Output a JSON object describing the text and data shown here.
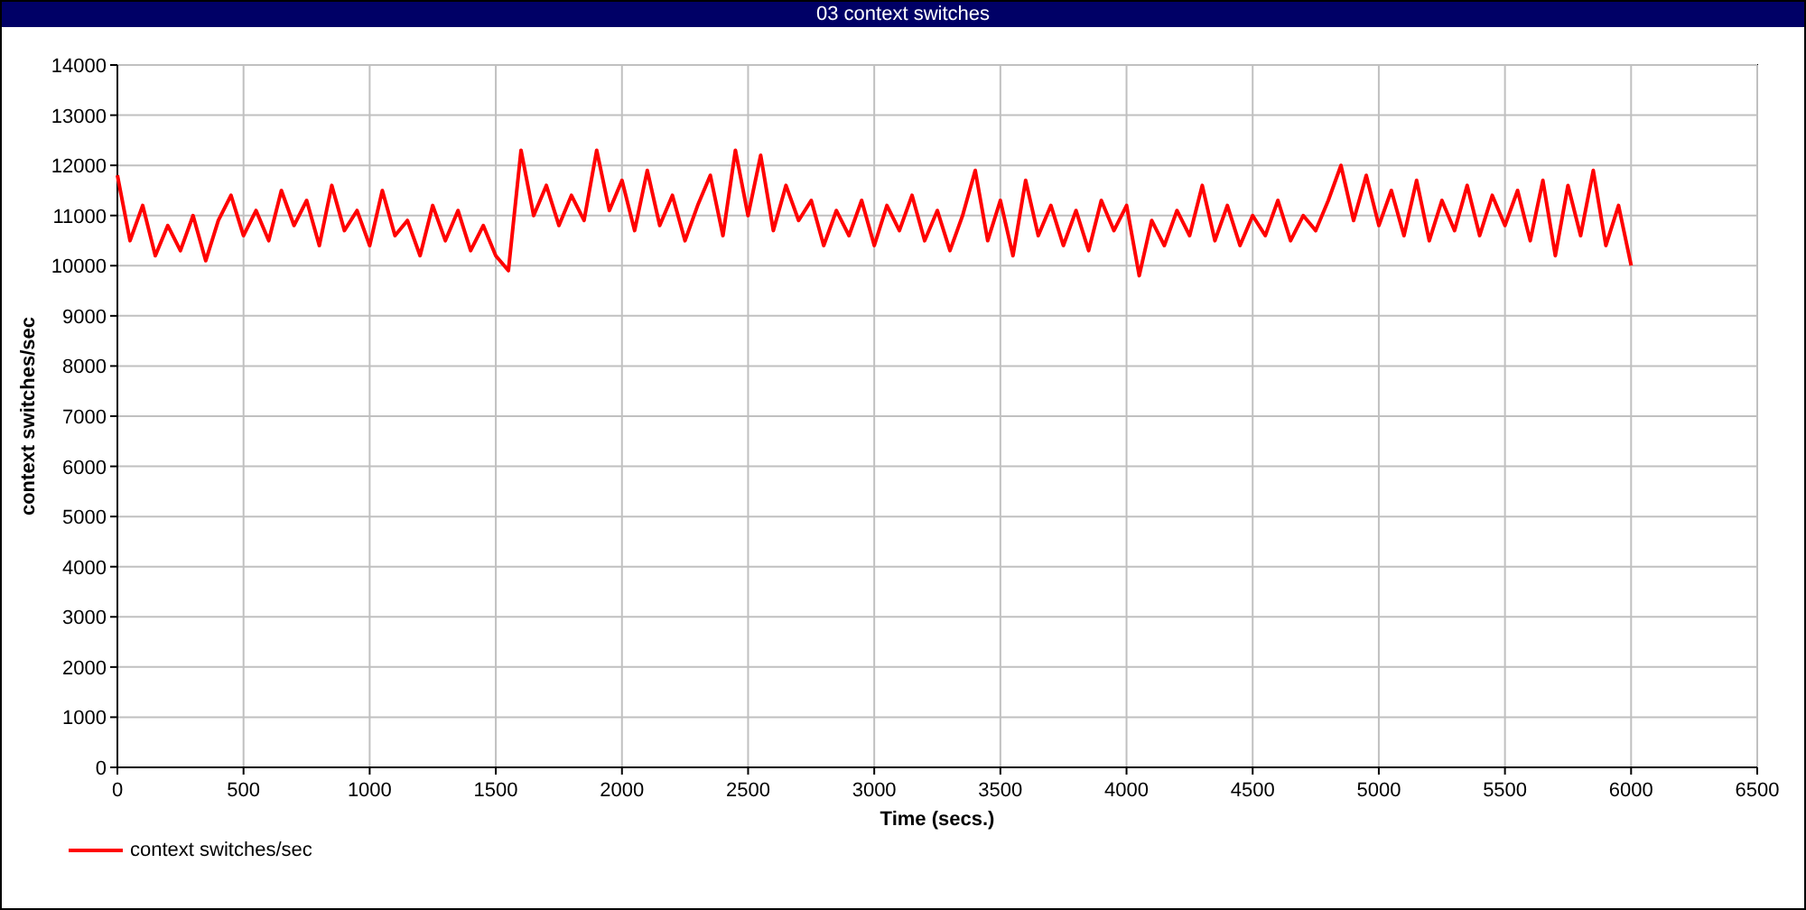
{
  "window": {
    "title": "03 context switches"
  },
  "chart": {
    "chart_data": {
      "type": "line",
      "grid": true,
      "xlabel": "Time (secs.)",
      "ylabel": "context switches/sec",
      "xlim": [
        0,
        6500
      ],
      "ylim": [
        0,
        14000
      ],
      "xticks": [
        0,
        500,
        1000,
        1500,
        2000,
        2500,
        3000,
        3500,
        4000,
        4500,
        5000,
        5500,
        6000,
        6500
      ],
      "yticks": [
        0,
        1000,
        2000,
        3000,
        4000,
        5000,
        6000,
        7000,
        8000,
        9000,
        10000,
        11000,
        12000,
        13000,
        14000
      ],
      "x": [
        0,
        50,
        100,
        150,
        200,
        250,
        300,
        350,
        400,
        450,
        500,
        550,
        600,
        650,
        700,
        750,
        800,
        850,
        900,
        950,
        1000,
        1050,
        1100,
        1150,
        1200,
        1250,
        1300,
        1350,
        1400,
        1450,
        1500,
        1550,
        1600,
        1650,
        1700,
        1750,
        1800,
        1850,
        1900,
        1950,
        2000,
        2050,
        2100,
        2150,
        2200,
        2250,
        2300,
        2350,
        2400,
        2450,
        2500,
        2550,
        2600,
        2650,
        2700,
        2750,
        2800,
        2850,
        2900,
        2950,
        3000,
        3050,
        3100,
        3150,
        3200,
        3250,
        3300,
        3350,
        3400,
        3450,
        3500,
        3550,
        3600,
        3650,
        3700,
        3750,
        3800,
        3850,
        3900,
        3950,
        4000,
        4050,
        4100,
        4150,
        4200,
        4250,
        4300,
        4350,
        4400,
        4450,
        4500,
        4550,
        4600,
        4650,
        4700,
        4750,
        4800,
        4850,
        4900,
        4950,
        5000,
        5050,
        5100,
        5150,
        5200,
        5250,
        5300,
        5350,
        5400,
        5450,
        5500,
        5550,
        5600,
        5650,
        5700,
        5750,
        5800,
        5850,
        5900,
        5950,
        6000
      ],
      "series": [
        {
          "name": "context switches/sec",
          "color": "#ff0000",
          "values": [
            11800,
            10500,
            11200,
            10200,
            10800,
            10300,
            11000,
            10100,
            10900,
            11400,
            10600,
            11100,
            10500,
            11500,
            10800,
            11300,
            10400,
            11600,
            10700,
            11100,
            10400,
            11500,
            10600,
            10900,
            10200,
            11200,
            10500,
            11100,
            10300,
            10800,
            10200,
            9900,
            12300,
            11000,
            11600,
            10800,
            11400,
            10900,
            12300,
            11100,
            11700,
            10700,
            11900,
            10800,
            11400,
            10500,
            11200,
            11800,
            10600,
            12300,
            11000,
            12200,
            10700,
            11600,
            10900,
            11300,
            10400,
            11100,
            10600,
            11300,
            10400,
            11200,
            10700,
            11400,
            10500,
            11100,
            10300,
            11000,
            11900,
            10500,
            11300,
            10200,
            11700,
            10600,
            11200,
            10400,
            11100,
            10300,
            11300,
            10700,
            11200,
            9800,
            10900,
            10400,
            11100,
            10600,
            11600,
            10500,
            11200,
            10400,
            11000,
            10600,
            11300,
            10500,
            11000,
            10700,
            11300,
            12000,
            10900,
            11800,
            10800,
            11500,
            10600,
            11700,
            10500,
            11300,
            10700,
            11600,
            10600,
            11400,
            10800,
            11500,
            10500,
            11700,
            10200,
            11600,
            10600,
            11900,
            10400,
            11200,
            10000
          ]
        }
      ]
    }
  }
}
